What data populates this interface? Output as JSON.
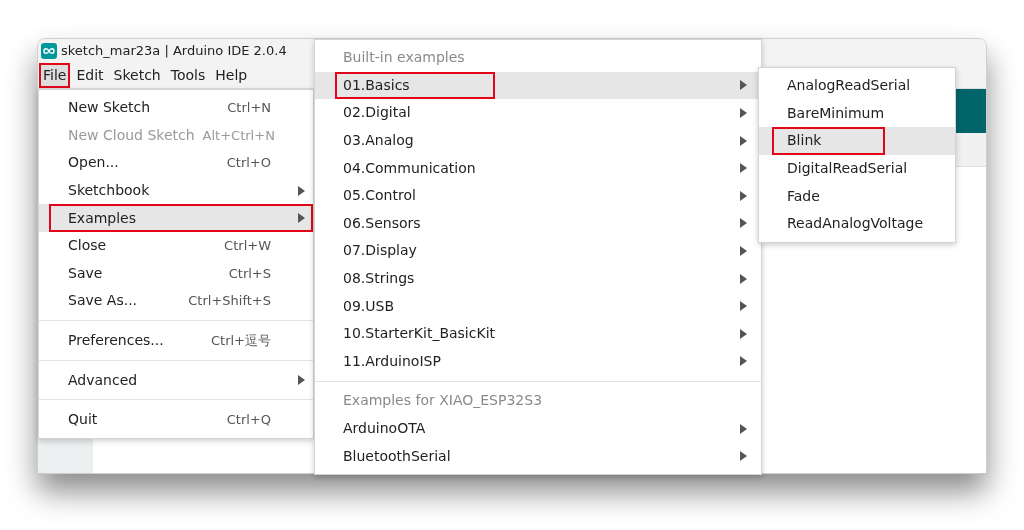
{
  "window": {
    "title": "sketch_mar23a | Arduino IDE 2.0.4"
  },
  "menubar": [
    {
      "label": "File",
      "selected": true,
      "annotated": true
    },
    {
      "label": "Edit",
      "selected": false,
      "annotated": false
    },
    {
      "label": "Sketch",
      "selected": false,
      "annotated": false
    },
    {
      "label": "Tools",
      "selected": false,
      "annotated": false
    },
    {
      "label": "Help",
      "selected": false,
      "annotated": false
    }
  ],
  "file_menu": {
    "items": [
      {
        "kind": "item",
        "label": "New Sketch",
        "shortcut": "Ctrl+N",
        "disabled": false,
        "has_submenu": false,
        "selected": false,
        "annotated": false
      },
      {
        "kind": "item",
        "label": "New Cloud Sketch",
        "shortcut": "Alt+Ctrl+N",
        "disabled": true,
        "has_submenu": false,
        "selected": false,
        "annotated": false
      },
      {
        "kind": "item",
        "label": "Open...",
        "shortcut": "Ctrl+O",
        "disabled": false,
        "has_submenu": false,
        "selected": false,
        "annotated": false
      },
      {
        "kind": "item",
        "label": "Sketchbook",
        "disabled": false,
        "has_submenu": true,
        "selected": false,
        "annotated": false
      },
      {
        "kind": "item",
        "label": "Examples",
        "disabled": false,
        "has_submenu": true,
        "selected": true,
        "annotated": true
      },
      {
        "kind": "item",
        "label": "Close",
        "shortcut": "Ctrl+W",
        "disabled": false,
        "has_submenu": false,
        "selected": false,
        "annotated": false
      },
      {
        "kind": "item",
        "label": "Save",
        "shortcut": "Ctrl+S",
        "disabled": false,
        "has_submenu": false,
        "selected": false,
        "annotated": false
      },
      {
        "kind": "item",
        "label": "Save As...",
        "shortcut": "Ctrl+Shift+S",
        "disabled": false,
        "has_submenu": false,
        "selected": false,
        "annotated": false
      },
      {
        "kind": "separator"
      },
      {
        "kind": "item",
        "label": "Preferences...",
        "shortcut": "Ctrl+逗号",
        "disabled": false,
        "has_submenu": false,
        "selected": false,
        "annotated": false
      },
      {
        "kind": "separator"
      },
      {
        "kind": "item",
        "label": "Advanced",
        "disabled": false,
        "has_submenu": true,
        "selected": false,
        "annotated": false
      },
      {
        "kind": "separator"
      },
      {
        "kind": "item",
        "label": "Quit",
        "shortcut": "Ctrl+Q",
        "disabled": false,
        "has_submenu": false,
        "selected": false,
        "annotated": false
      }
    ]
  },
  "examples_menu": {
    "items": [
      {
        "kind": "header",
        "label": "Built-in examples"
      },
      {
        "kind": "item",
        "label": "01.Basics",
        "has_submenu": true,
        "selected": true,
        "annotated": true
      },
      {
        "kind": "item",
        "label": "02.Digital",
        "has_submenu": true,
        "selected": false,
        "annotated": false
      },
      {
        "kind": "item",
        "label": "03.Analog",
        "has_submenu": true,
        "selected": false,
        "annotated": false
      },
      {
        "kind": "item",
        "label": "04.Communication",
        "has_submenu": true,
        "selected": false,
        "annotated": false
      },
      {
        "kind": "item",
        "label": "05.Control",
        "has_submenu": true,
        "selected": false,
        "annotated": false
      },
      {
        "kind": "item",
        "label": "06.Sensors",
        "has_submenu": true,
        "selected": false,
        "annotated": false
      },
      {
        "kind": "item",
        "label": "07.Display",
        "has_submenu": true,
        "selected": false,
        "annotated": false
      },
      {
        "kind": "item",
        "label": "08.Strings",
        "has_submenu": true,
        "selected": false,
        "annotated": false
      },
      {
        "kind": "item",
        "label": "09.USB",
        "has_submenu": true,
        "selected": false,
        "annotated": false
      },
      {
        "kind": "item",
        "label": "10.StarterKit_BasicKit",
        "has_submenu": true,
        "selected": false,
        "annotated": false
      },
      {
        "kind": "item",
        "label": "11.ArduinoISP",
        "has_submenu": true,
        "selected": false,
        "annotated": false
      },
      {
        "kind": "separator"
      },
      {
        "kind": "header",
        "label": "Examples for XIAO_ESP32S3"
      },
      {
        "kind": "item",
        "label": "ArduinoOTA",
        "has_submenu": true,
        "selected": false,
        "annotated": false
      },
      {
        "kind": "item",
        "label": "BluetoothSerial",
        "has_submenu": true,
        "selected": false,
        "annotated": false
      }
    ]
  },
  "basics_menu": {
    "items": [
      {
        "kind": "item",
        "label": "AnalogReadSerial",
        "has_submenu": false,
        "selected": false,
        "annotated": false
      },
      {
        "kind": "item",
        "label": "BareMinimum",
        "has_submenu": false,
        "selected": false,
        "annotated": false
      },
      {
        "kind": "item",
        "label": "Blink",
        "has_submenu": false,
        "selected": true,
        "annotated": true
      },
      {
        "kind": "item",
        "label": "DigitalReadSerial",
        "has_submenu": false,
        "selected": false,
        "annotated": false
      },
      {
        "kind": "item",
        "label": "Fade",
        "has_submenu": false,
        "selected": false,
        "annotated": false
      },
      {
        "kind": "item",
        "label": "ReadAnalogVoltage",
        "has_submenu": false,
        "selected": false,
        "annotated": false
      }
    ]
  }
}
